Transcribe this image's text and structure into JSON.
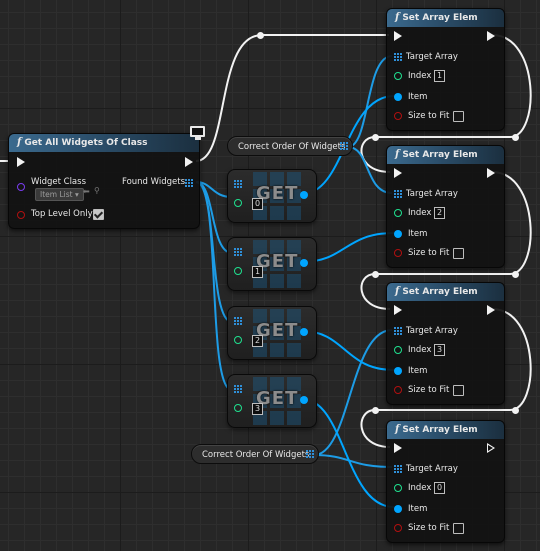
{
  "colors": {
    "exec": "#f2f2f2",
    "array": "#2f8fd8",
    "object": "#00a5ff",
    "int": "#1fe08f",
    "bool": "#a10000",
    "class": "#5a00e0",
    "header": "#3b6a8e"
  },
  "get_all": {
    "title": "Get All Widgets Of Class",
    "icon": "function-icon",
    "widget_class_label": "Widget Class",
    "widget_class_value": "Item List",
    "found_widgets_label": "Found Widgets",
    "top_level_only_label": "Top Level Only",
    "top_level_only_checked": true
  },
  "variables": {
    "correct_order_top": "Correct Order Of Widgets",
    "correct_order_bottom": "Correct Order Of Widgets"
  },
  "get_nodes": [
    {
      "label": "GET",
      "index": "0"
    },
    {
      "label": "GET",
      "index": "1"
    },
    {
      "label": "GET",
      "index": "2"
    },
    {
      "label": "GET",
      "index": "3"
    }
  ],
  "set_nodes": [
    {
      "title": "Set Array Elem",
      "target": "Target Array",
      "index_label": "Index",
      "index": "1",
      "item": "Item",
      "size_to_fit": "Size to Fit"
    },
    {
      "title": "Set Array Elem",
      "target": "Target Array",
      "index_label": "Index",
      "index": "2",
      "item": "Item",
      "size_to_fit": "Size to Fit"
    },
    {
      "title": "Set Array Elem",
      "target": "Target Array",
      "index_label": "Index",
      "index": "3",
      "item": "Item",
      "size_to_fit": "Size to Fit"
    },
    {
      "title": "Set Array Elem",
      "target": "Target Array",
      "index_label": "Index",
      "index": "0",
      "item": "Item",
      "size_to_fit": "Size to Fit"
    }
  ]
}
